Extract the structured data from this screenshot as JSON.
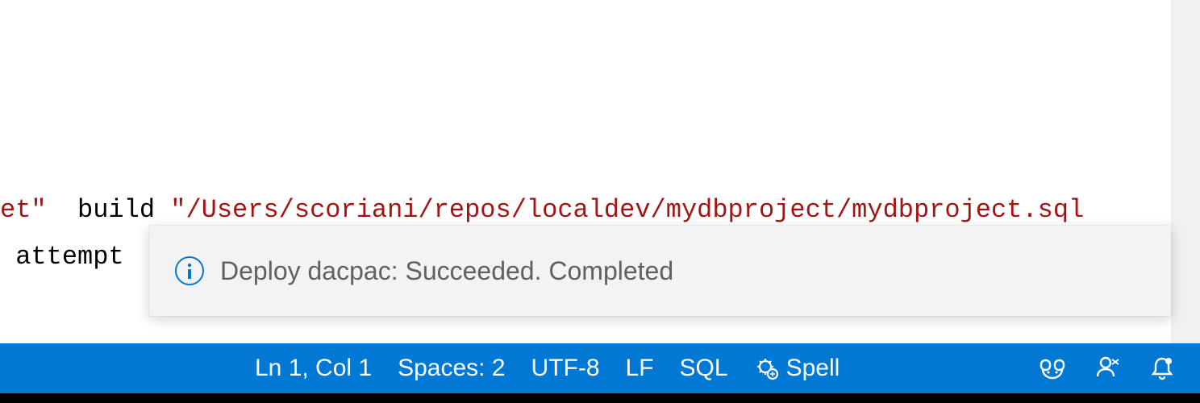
{
  "editor": {
    "line1": {
      "s1": "et\"",
      "plain": "  build ",
      "s2": "\"/Users/scoriani/repos/localdev/mydbproject/mydbproject.sql"
    },
    "line2": " attempt"
  },
  "notification": {
    "icon": "info-icon",
    "message": "Deploy dacpac: Succeeded. Completed"
  },
  "statusbar": {
    "cursor": "Ln 1, Col 1",
    "spaces": "Spaces: 2",
    "encoding": "UTF-8",
    "eol": "LF",
    "language": "SQL",
    "spell": "Spell",
    "icons": {
      "sparkle": "sparkle-bug-icon",
      "copilot": "copilot-icon",
      "account": "account-icon",
      "bell": "bell-icon"
    }
  }
}
